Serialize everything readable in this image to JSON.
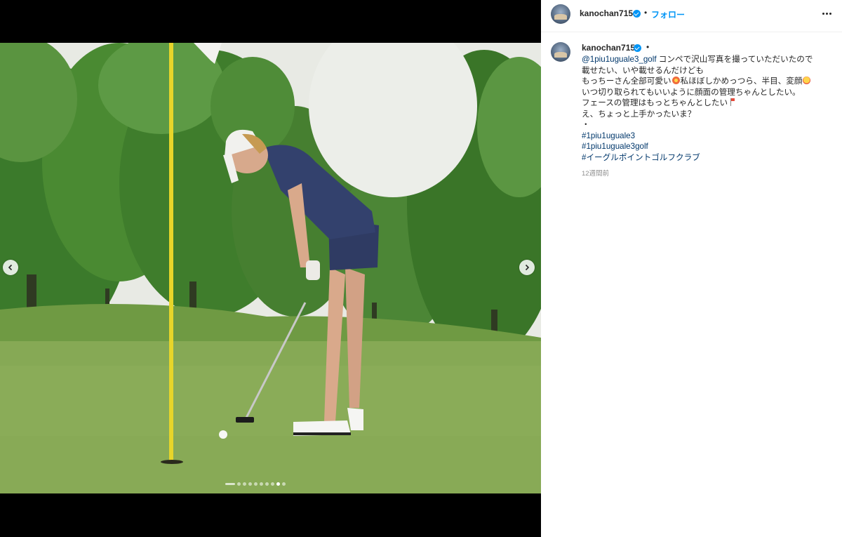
{
  "post": {
    "username": "kanochan715",
    "follow_label": "フォロー",
    "separator": "•"
  },
  "media": {
    "image_description_icon": "photo",
    "dots_total": 10,
    "dots_active_index": 8
  },
  "caption": {
    "username": "kanochan715",
    "mention": "@1piu1uguale3_golf",
    "line1_rest": " コンペで沢山写真を撮っていただいたので",
    "line2": "載せたい、いや載せるんだけども",
    "line3a": "もっちーさん全部可愛い",
    "line3b": "私ほぼしかめっつら、半目、変顔",
    "line4": "いつ切り取られてもいいように顔面の管理ちゃんとしたい。",
    "line5": "フェースの管理はもっとちゃんとしたい",
    "line6": "え、ちょっと上手かったいま？",
    "line7": "・",
    "hashtags": [
      "#1piu1uguale3",
      "#1piu1uguale3golf",
      "#イーグルポイントゴルフクラブ"
    ],
    "time": "12週間前"
  },
  "icons": {
    "prev": "chevron-left-icon",
    "next": "chevron-right-icon",
    "more": "more-horizontal-icon",
    "verified": "verified-badge-icon"
  },
  "colors": {
    "link": "#0095f6",
    "hashtag": "#00376b",
    "text": "#262626",
    "muted": "#8e8e8e"
  }
}
